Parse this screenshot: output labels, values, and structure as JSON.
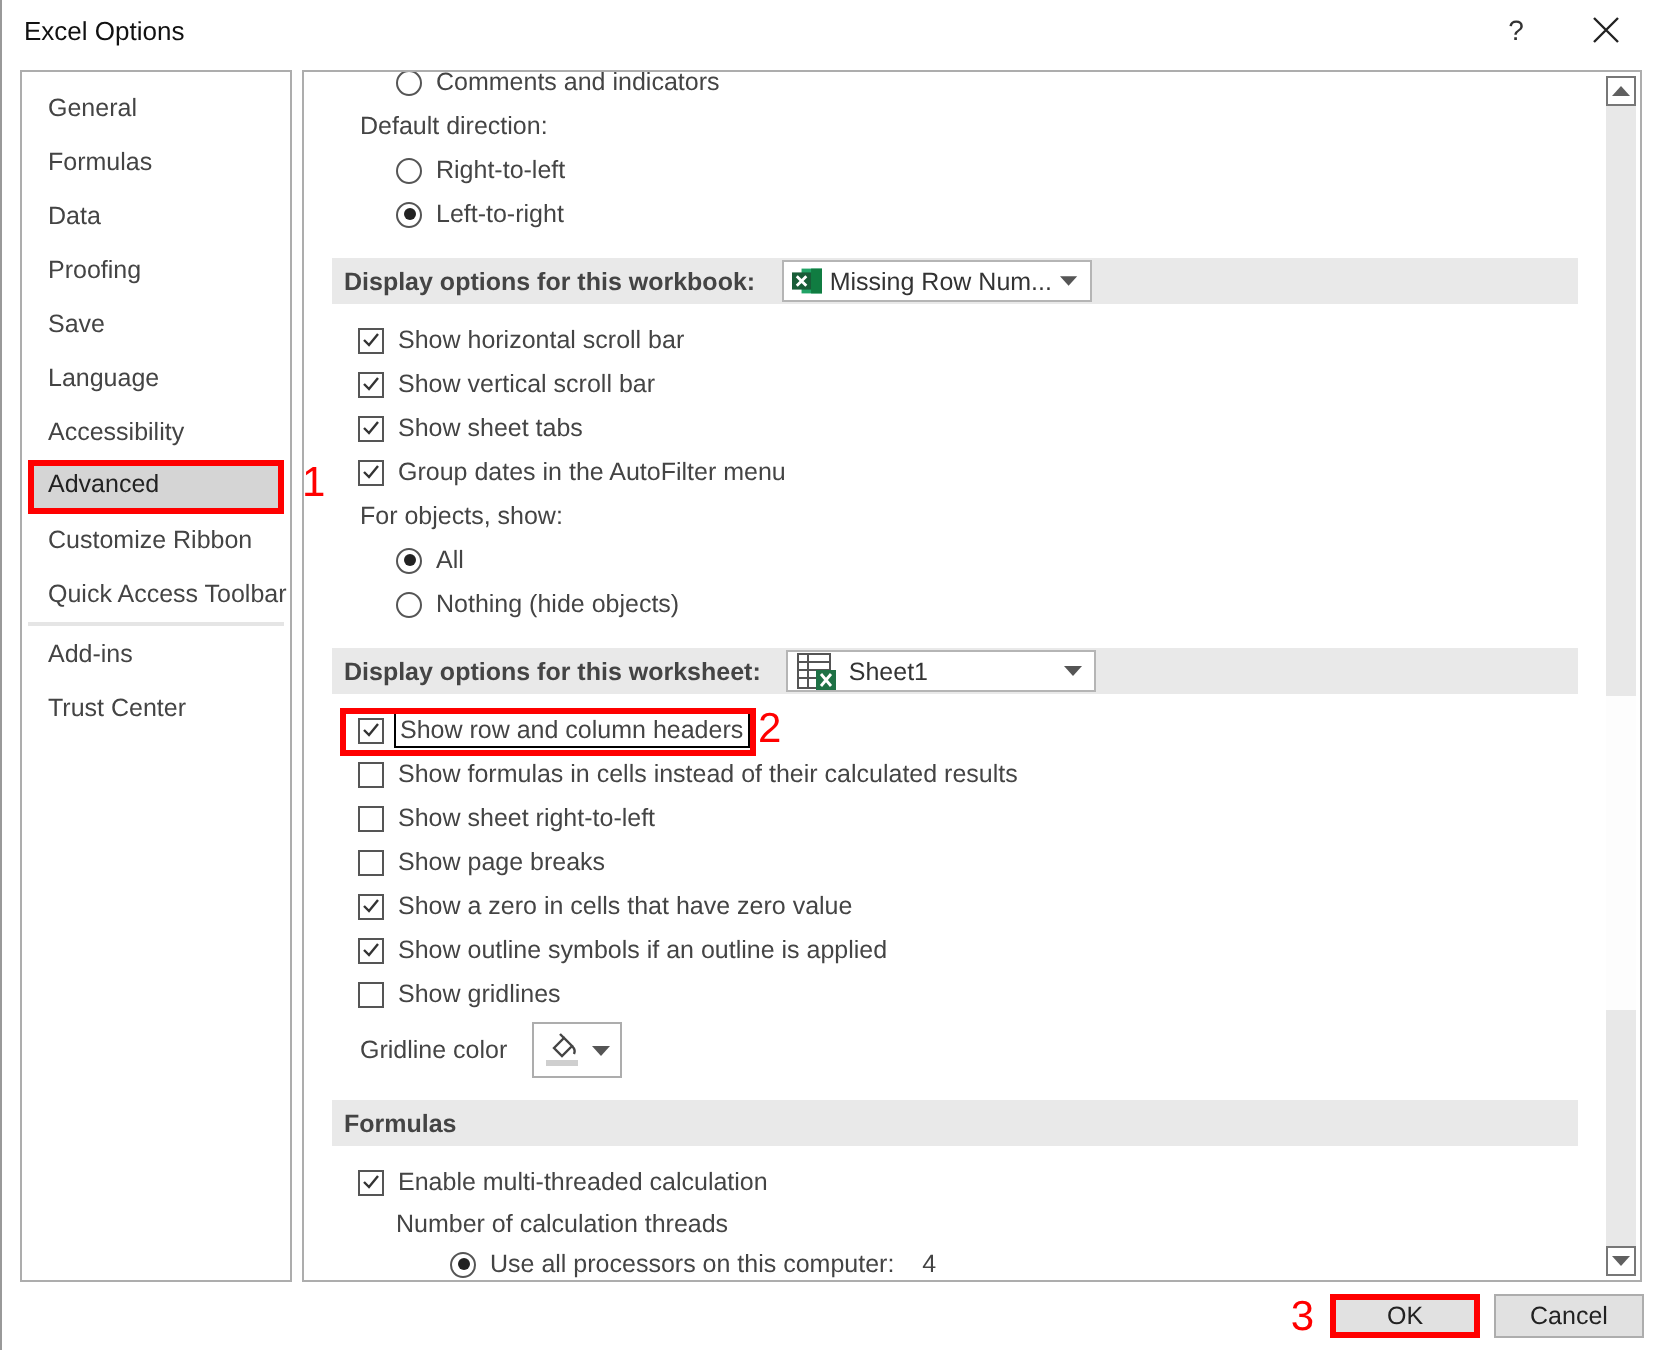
{
  "window": {
    "title": "Excel Options",
    "help": "?"
  },
  "sidebar": {
    "groups": [
      {
        "items": [
          {
            "label": "General",
            "selected": false
          },
          {
            "label": "Formulas",
            "selected": false
          },
          {
            "label": "Data",
            "selected": false
          },
          {
            "label": "Proofing",
            "selected": false
          },
          {
            "label": "Save",
            "selected": false
          },
          {
            "label": "Language",
            "selected": false
          },
          {
            "label": "Accessibility",
            "selected": false
          },
          {
            "label": "Advanced",
            "selected": true,
            "highlighted": true,
            "callout": "1"
          },
          {
            "label": "Customize Ribbon",
            "selected": false
          },
          {
            "label": "Quick Access Toolbar",
            "selected": false
          }
        ]
      },
      {
        "items": [
          {
            "label": "Add-ins",
            "selected": false
          },
          {
            "label": "Trust Center",
            "selected": false
          }
        ]
      }
    ]
  },
  "content": {
    "items": [
      {
        "kind": "radio",
        "label": "Comments and indicators",
        "selected": false
      },
      {
        "kind": "label",
        "label": "Default direction:"
      },
      {
        "kind": "radio",
        "label": "Right-to-left",
        "selected": false
      },
      {
        "kind": "radio",
        "label": "Left-to-right",
        "selected": true
      },
      {
        "kind": "section",
        "label": "Display options for this workbook:",
        "dropdown": {
          "value": "Missing Row Num..."
        }
      },
      {
        "kind": "checkbox",
        "label": "Show horizontal scroll bar",
        "checked": true
      },
      {
        "kind": "checkbox",
        "label": "Show vertical scroll bar",
        "checked": true
      },
      {
        "kind": "checkbox",
        "label": "Show sheet tabs",
        "checked": true
      },
      {
        "kind": "checkbox",
        "label": "Group dates in the AutoFilter menu",
        "checked": true
      },
      {
        "kind": "label",
        "label": "For objects, show:"
      },
      {
        "kind": "radio",
        "label": "All",
        "selected": true
      },
      {
        "kind": "radio",
        "label": "Nothing (hide objects)",
        "selected": false
      },
      {
        "kind": "section",
        "label": "Display options for this worksheet:",
        "dropdown": {
          "value": "Sheet1"
        }
      },
      {
        "kind": "checkbox",
        "label": "Show row and column headers",
        "checked": true,
        "highlighted": true,
        "focused": true,
        "callout": "2"
      },
      {
        "kind": "checkbox",
        "label": "Show formulas in cells instead of their calculated results",
        "checked": false
      },
      {
        "kind": "checkbox",
        "label": "Show sheet right-to-left",
        "checked": false
      },
      {
        "kind": "checkbox",
        "label": "Show page breaks",
        "checked": false
      },
      {
        "kind": "checkbox",
        "label": "Show a zero in cells that have zero value",
        "checked": true
      },
      {
        "kind": "checkbox",
        "label": "Show outline symbols if an outline is applied",
        "checked": true
      },
      {
        "kind": "checkbox",
        "label": "Show gridlines",
        "checked": false
      },
      {
        "kind": "color",
        "label": "Gridline color"
      },
      {
        "kind": "section",
        "label": "Formulas"
      },
      {
        "kind": "checkbox",
        "label": "Enable multi-threaded calculation",
        "checked": true
      },
      {
        "kind": "sublabel",
        "label": "Number of calculation threads"
      },
      {
        "kind": "subradio",
        "label": "Use all processors on this computer:",
        "value": "4",
        "selected": true
      }
    ]
  },
  "buttons": [
    {
      "label": "OK",
      "highlighted": true,
      "callout": "3"
    },
    {
      "label": "Cancel",
      "highlighted": false
    }
  ]
}
